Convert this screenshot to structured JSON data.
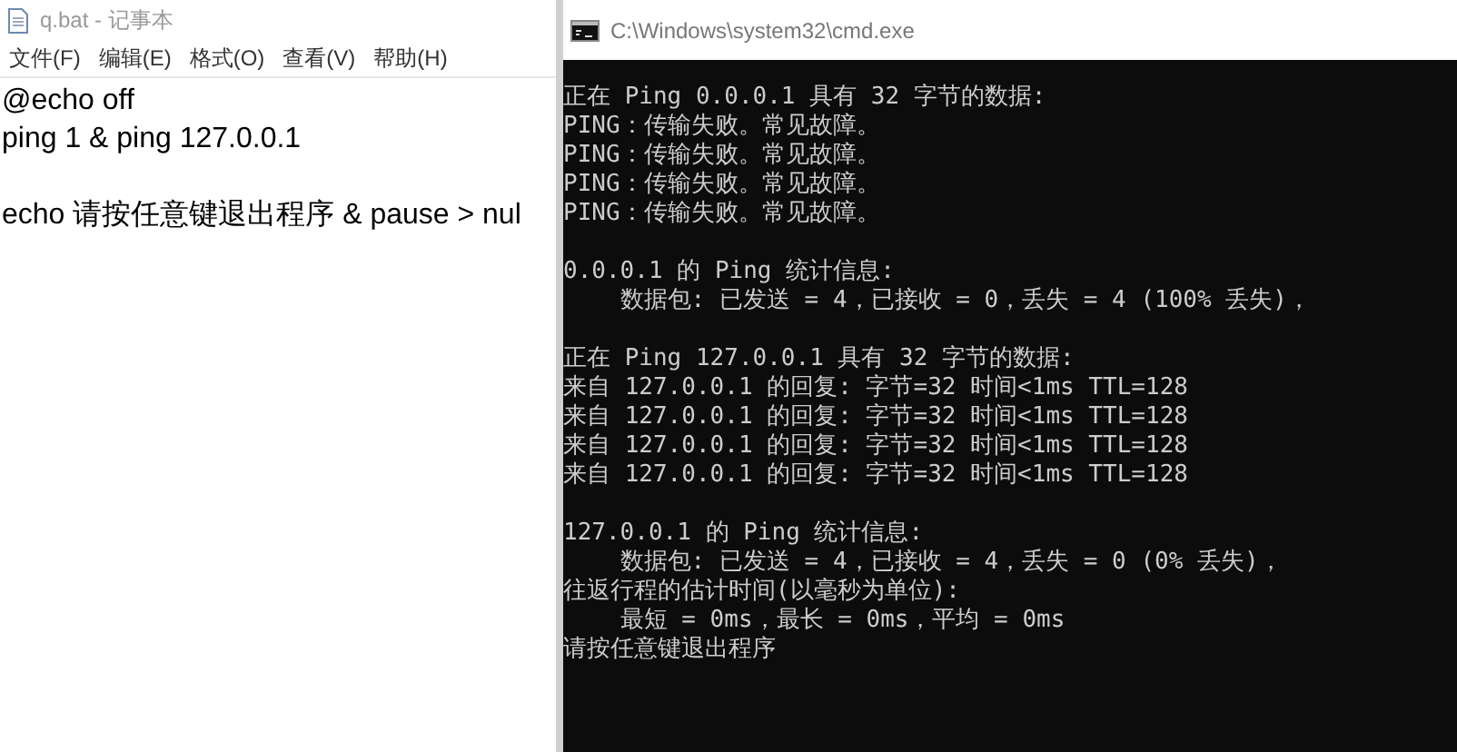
{
  "notepad": {
    "title": "q.bat - 记事本",
    "menu": [
      {
        "label": "文件(F)"
      },
      {
        "label": "编辑(E)"
      },
      {
        "label": "格式(O)"
      },
      {
        "label": "查看(V)"
      },
      {
        "label": "帮助(H)"
      }
    ],
    "text_blocks": [
      [
        "@echo off",
        "ping 1 & ping 127.0.0.1"
      ],
      [
        "echo 请按任意键退出程序 & pause > nul"
      ]
    ]
  },
  "console": {
    "title": "C:\\Windows\\system32\\cmd.exe",
    "output_blocks": [
      [
        "正在 Ping 0.0.0.1 具有 32 字节的数据:",
        "PING：传输失败。常见故障。",
        "PING：传输失败。常见故障。",
        "PING：传输失败。常见故障。",
        "PING：传输失败。常见故障。"
      ],
      [
        "0.0.0.1 的 Ping 统计信息:",
        "    数据包: 已发送 = 4，已接收 = 0，丢失 = 4 (100% 丢失)，"
      ],
      [
        "正在 Ping 127.0.0.1 具有 32 字节的数据:",
        "来自 127.0.0.1 的回复: 字节=32 时间<1ms TTL=128",
        "来自 127.0.0.1 的回复: 字节=32 时间<1ms TTL=128",
        "来自 127.0.0.1 的回复: 字节=32 时间<1ms TTL=128",
        "来自 127.0.0.1 的回复: 字节=32 时间<1ms TTL=128"
      ],
      [
        "127.0.0.1 的 Ping 统计信息:",
        "    数据包: 已发送 = 4，已接收 = 4，丢失 = 0 (0% 丢失)，",
        "往返行程的估计时间(以毫秒为单位):",
        "    最短 = 0ms，最长 = 0ms，平均 = 0ms",
        "请按任意键退出程序"
      ]
    ]
  }
}
